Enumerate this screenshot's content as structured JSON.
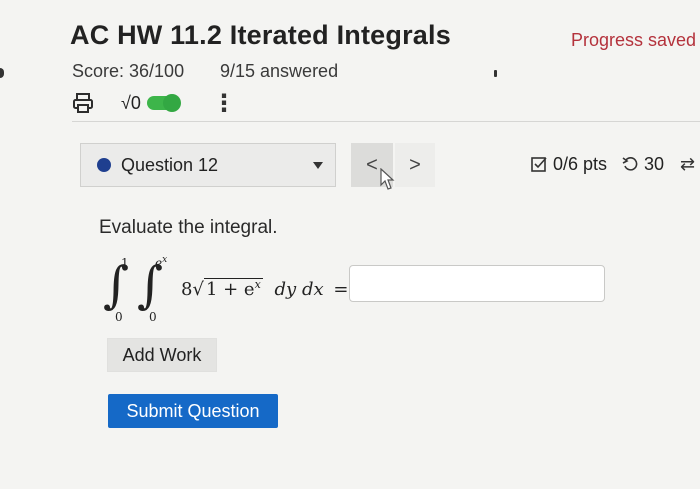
{
  "header": {
    "title": "AC HW 11.2 Iterated Integrals",
    "progress_status": "Progress saved",
    "score": "Score: 36/100",
    "answered": "9/15 answered"
  },
  "toolbar": {
    "print_icon": "printer-icon",
    "math_toggle_label": "√0",
    "math_toggle_on": true,
    "more_icon": "vertical-ellipsis-icon",
    "toggle_color": "#3db54a"
  },
  "question_nav": {
    "selected": "Question 12",
    "prev_label": "<",
    "next_label": ">",
    "question_dot_color": "#1f3f8f"
  },
  "question_meta": {
    "points": "0/6 pts",
    "attempts": "30"
  },
  "question": {
    "prompt": "Evaluate the integral.",
    "outer_upper": "1",
    "outer_lower": "0",
    "inner_upper_base": "e",
    "inner_upper_exp": "x",
    "inner_lower": "0",
    "coefficient": "8",
    "radicand": "1 + e",
    "radicand_exp": "x",
    "differentials": "dy dx",
    "equals": "=",
    "answer_value": ""
  },
  "actions": {
    "add_work": "Add Work",
    "submit": "Submit Question",
    "submit_color": "#1569c7"
  }
}
